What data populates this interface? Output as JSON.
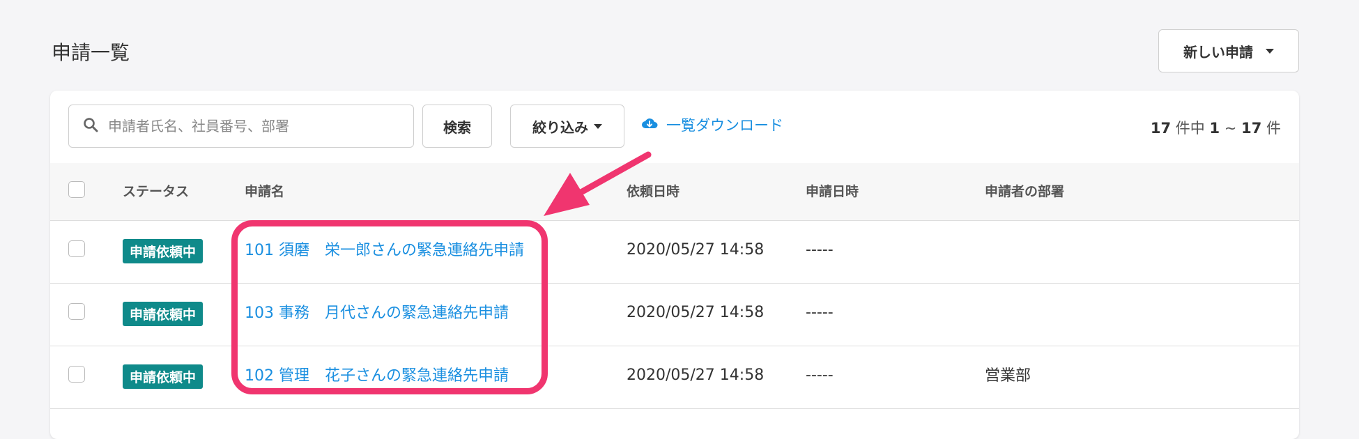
{
  "header": {
    "title": "申請一覧",
    "new_button_label": "新しい申請"
  },
  "toolbar": {
    "search_placeholder": "申請者氏名、社員番号、部署",
    "search_button_label": "検索",
    "filter_button_label": "絞り込み",
    "download_label": "一覧ダウンロード",
    "count": {
      "total": "17",
      "total_suffix": "件中",
      "from": "1",
      "sep": "~",
      "to": "17",
      "to_suffix": "件"
    }
  },
  "table": {
    "columns": [
      "ステータス",
      "申請名",
      "依頼日時",
      "申請日時",
      "申請者の部署"
    ],
    "rows": [
      {
        "status": "申請依頼中",
        "name": "101 須磨　栄一郎さんの緊急連絡先申請",
        "requested_at": "2020/05/27 14:58",
        "applied_at": "-----",
        "department": ""
      },
      {
        "status": "申請依頼中",
        "name": "103 事務　月代さんの緊急連絡先申請",
        "requested_at": "2020/05/27 14:58",
        "applied_at": "-----",
        "department": ""
      },
      {
        "status": "申請依頼中",
        "name": "102 管理　花子さんの緊急連絡先申請",
        "requested_at": "2020/05/27 14:58",
        "applied_at": "-----",
        "department": "営業部"
      }
    ]
  },
  "colors": {
    "accent": "#1a8fe0",
    "status_badge": "#0f8a8a",
    "annotation": "#f0356f"
  },
  "icons": {
    "search": "search-icon",
    "caret": "caret-down-icon",
    "download": "cloud-download-icon"
  }
}
